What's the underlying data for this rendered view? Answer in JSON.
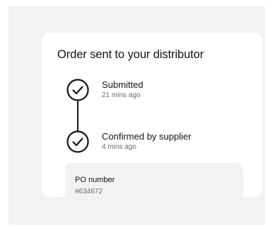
{
  "colors": {
    "background": "#f2f2f3",
    "card": "#ffffff",
    "text_primary": "#141414",
    "text_secondary": "#6b6b70"
  },
  "order": {
    "title": "Order sent to your distributor",
    "steps": [
      {
        "label": "Submitted",
        "time": "21 mins ago",
        "icon": "check-circle-icon"
      },
      {
        "label": "Confirmed by supplier",
        "time": "4 mins ago",
        "icon": "check-circle-icon"
      }
    ],
    "po": {
      "label": "PO number",
      "value": "#634672"
    }
  }
}
